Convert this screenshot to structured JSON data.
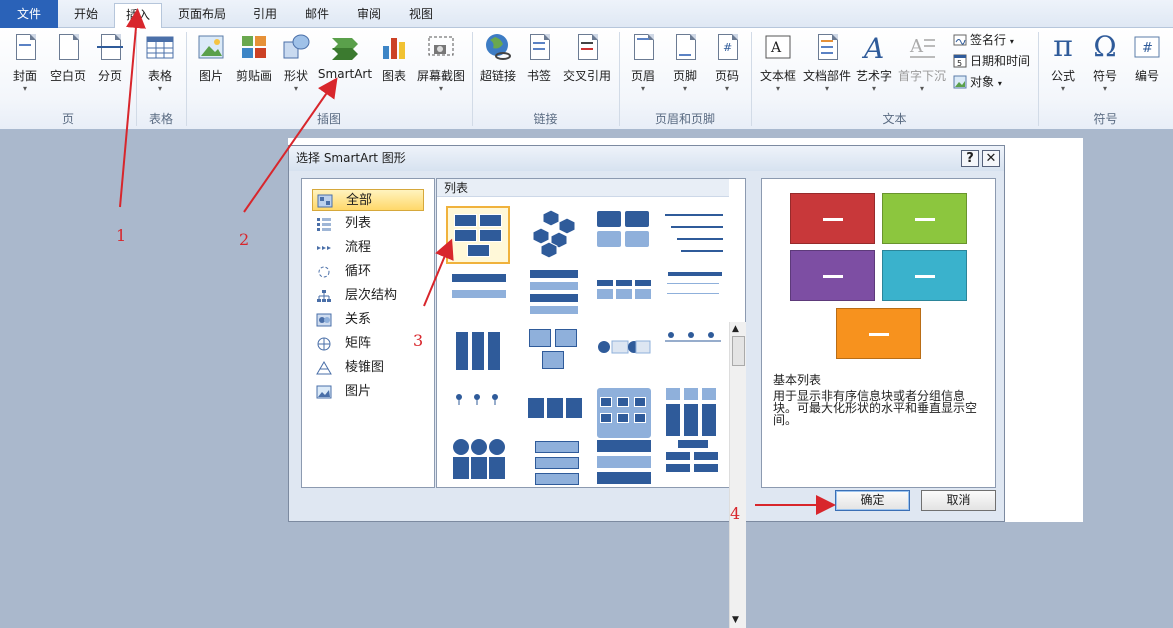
{
  "tabs": [
    {
      "label": "文件"
    },
    {
      "label": "开始"
    },
    {
      "label": "插入"
    },
    {
      "label": "页面布局"
    },
    {
      "label": "引用"
    },
    {
      "label": "邮件"
    },
    {
      "label": "审阅"
    },
    {
      "label": "视图"
    }
  ],
  "ribbon": {
    "buttons": [
      {
        "label": "封面",
        "has_arrow": true,
        "icon": "cover-page-icon"
      },
      {
        "label": "空白页",
        "icon": "blank-page-icon"
      },
      {
        "label": "分页",
        "icon": "page-break-icon"
      },
      {
        "label": "表格",
        "has_arrow": true,
        "icon": "table-icon"
      },
      {
        "label": "图片",
        "icon": "picture-icon"
      },
      {
        "label": "剪贴画",
        "icon": "clip-art-icon"
      },
      {
        "label": "形状",
        "has_arrow": true,
        "icon": "shapes-icon"
      },
      {
        "label": "SmartArt",
        "icon": "smartart-icon"
      },
      {
        "label": "图表",
        "icon": "chart-icon"
      },
      {
        "label": "屏幕截图",
        "has_arrow": true,
        "icon": "screenshot-icon"
      },
      {
        "label": "超链接",
        "icon": "hyperlink-icon"
      },
      {
        "label": "书签",
        "icon": "bookmark-icon"
      },
      {
        "label": "交叉引用",
        "icon": "cross-reference-icon"
      },
      {
        "label": "页眉",
        "has_arrow": true,
        "icon": "header-icon"
      },
      {
        "label": "页脚",
        "has_arrow": true,
        "icon": "footer-icon"
      },
      {
        "label": "页码",
        "has_arrow": true,
        "icon": "page-number-icon"
      },
      {
        "label": "文本框",
        "has_arrow": true,
        "icon": "text-box-icon"
      },
      {
        "label": "文档部件",
        "has_arrow": true,
        "icon": "quick-parts-icon"
      },
      {
        "label": "艺术字",
        "has_arrow": true,
        "icon": "wordart-icon"
      },
      {
        "label": "首字下沉",
        "has_arrow": true,
        "icon": "drop-cap-icon",
        "disabled": true
      },
      {
        "label": "公式",
        "has_arrow": true,
        "icon": "equation-icon"
      },
      {
        "label": "符号",
        "has_arrow": true,
        "icon": "symbol-icon"
      },
      {
        "label": "编号",
        "icon": "number-icon"
      }
    ],
    "small_buttons": [
      {
        "label": "签名行",
        "has_arrow": true,
        "icon": "signature-line-icon"
      },
      {
        "label": "日期和时间",
        "icon": "date-time-icon"
      },
      {
        "label": "对象",
        "has_arrow": true,
        "icon": "object-icon"
      }
    ],
    "groups": [
      "页",
      "表格",
      "插图",
      "链接",
      "页眉和页脚",
      "文本",
      "符号"
    ]
  },
  "dialog": {
    "title": "选择 SmartArt 图形",
    "help_button": "?",
    "close_button": "✕",
    "categories": [
      {
        "label": "全部",
        "icon": "all-icon",
        "selected": true
      },
      {
        "label": "列表",
        "icon": "list-icon"
      },
      {
        "label": "流程",
        "icon": "process-icon"
      },
      {
        "label": "循环",
        "icon": "cycle-icon"
      },
      {
        "label": "层次结构",
        "icon": "hierarchy-icon"
      },
      {
        "label": "关系",
        "icon": "relationship-icon"
      },
      {
        "label": "矩阵",
        "icon": "matrix-icon"
      },
      {
        "label": "棱锥图",
        "icon": "pyramid-icon"
      },
      {
        "label": "图片",
        "icon": "picture-icon"
      }
    ],
    "gallery_header": "列表",
    "preview_title": "基本列表",
    "preview_desc_1": "用于显示非有序信息块或者分组信息",
    "preview_desc_2": "块。可最大化形状的水平和垂直显示空",
    "preview_desc_3": "间。",
    "preview_colors": [
      "#c8383a",
      "#8cc63e",
      "#7d4ea3",
      "#3ab2cc",
      "#f7921e"
    ],
    "ok_button": "确定",
    "cancel_button": "取消"
  },
  "annotations": [
    "1",
    "2",
    "3",
    "4"
  ],
  "colors": {
    "accent": "#2a62b8",
    "annotation": "#d8262c"
  }
}
